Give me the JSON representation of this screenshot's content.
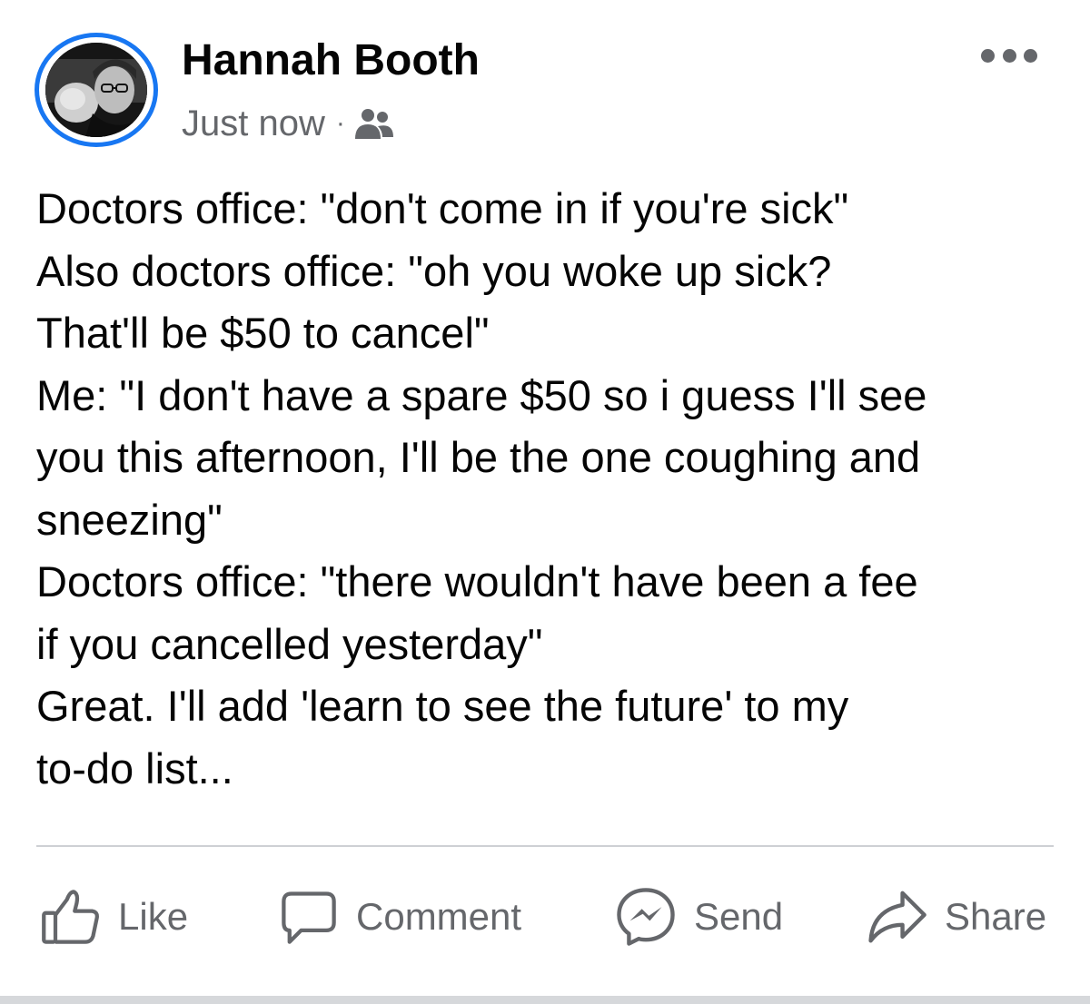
{
  "post": {
    "author_name": "Hannah Booth",
    "timestamp": "Just now",
    "separator": "·",
    "audience_icon": "friends-icon",
    "more_icon": "more-options-icon",
    "text_lines": [
      "Doctors office: \"don't come in if you're sick\"",
      "Also doctors office: \"oh you woke up sick?",
      "That'll be $50 to cancel\"",
      "Me: \"I don't have a spare $50 so i guess I'll see",
      "you this afternoon, I'll be the one coughing and",
      "sneezing\"",
      "Doctors office: \"there wouldn't have been a fee",
      "if you cancelled yesterday\"",
      "Great. I'll add 'learn to see the future' to my",
      "to-do list..."
    ]
  },
  "actions": {
    "like": {
      "label": "Like",
      "icon": "thumbs-up-icon"
    },
    "comment": {
      "label": "Comment",
      "icon": "speech-bubble-icon"
    },
    "send": {
      "label": "Send",
      "icon": "messenger-icon"
    },
    "share": {
      "label": "Share",
      "icon": "share-arrow-icon"
    }
  },
  "colors": {
    "accent": "#1877f2",
    "text_primary": "#050505",
    "text_secondary": "#65676b",
    "divider": "#ced0d4"
  }
}
